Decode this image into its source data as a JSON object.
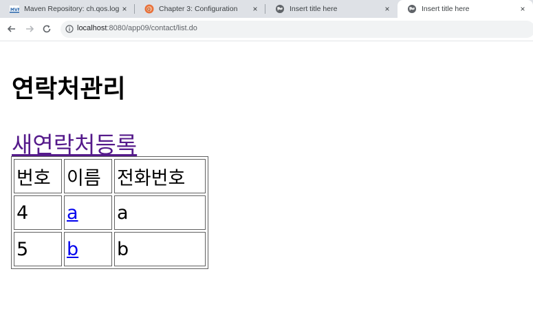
{
  "browser": {
    "tabs": [
      {
        "favicon": "maven-icon",
        "title": "Maven Repository: ch.qos.logb",
        "close": "×",
        "active": false
      },
      {
        "favicon": "qos-logback-icon",
        "title": "Chapter 3: Configuration",
        "close": "×",
        "active": false
      },
      {
        "favicon": "globe-icon",
        "title": "Insert title here",
        "close": "×",
        "active": false
      },
      {
        "favicon": "globe-icon",
        "title": "Insert title here",
        "close": "×",
        "active": true
      }
    ],
    "address": {
      "host": "localhost",
      "path": ":8080/app09/contact/list.do"
    }
  },
  "page": {
    "heading": "연락처관리",
    "new_contact_link": "새연락처등록",
    "table": {
      "headers": [
        "번호",
        "이름",
        "전화번호"
      ],
      "rows": [
        {
          "no": "4",
          "name": "a",
          "phone": "a"
        },
        {
          "no": "5",
          "name": "b",
          "phone": "b"
        }
      ]
    }
  },
  "colors": {
    "tabstrip": "#dee1e6",
    "visited_link": "#551a8b",
    "link": "#0000ee"
  }
}
